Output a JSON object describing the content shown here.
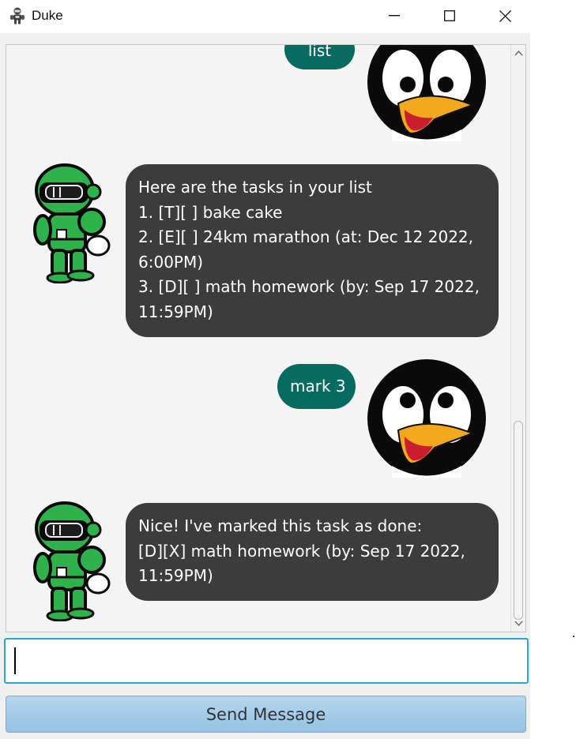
{
  "window": {
    "title": "Duke",
    "controls": {
      "minimize": "minimize-icon",
      "maximize": "maximize-icon",
      "close": "close-icon"
    }
  },
  "messages": [
    {
      "sender": "user",
      "lines": [
        "list"
      ]
    },
    {
      "sender": "duke",
      "lines": [
        "Here are the tasks in your list",
        "1. [T][ ] bake cake",
        "2. [E][ ] 24km marathon (at: Dec 12 2022,",
        "6:00PM)",
        "3. [D][ ] math homework (by: Sep 17 2022,",
        "11:59PM)"
      ]
    },
    {
      "sender": "user",
      "lines": [
        "mark 3"
      ]
    },
    {
      "sender": "duke",
      "lines": [
        "Nice! I've marked this task as done:",
        "[D][X] math homework (by: Sep 17 2022,",
        "11:59PM)"
      ]
    }
  ],
  "avatars": {
    "user": "penguin-avatar",
    "duke": "robot-avatar"
  },
  "input": {
    "value": "",
    "placeholder": ""
  },
  "send_button": {
    "label": "Send Message"
  },
  "colors": {
    "user_bubble": "#086b61",
    "duke_bubble": "#3c3c3c",
    "input_focus": "#27a8d8",
    "button": "#a6cdea"
  }
}
